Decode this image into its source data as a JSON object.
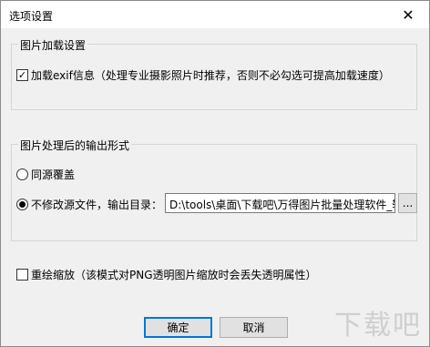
{
  "window": {
    "title": "选项设置",
    "close_glyph": "✕"
  },
  "loading_group": {
    "title": "图片加载设置",
    "exif_checkbox": {
      "checked": true,
      "label": "加载exif信息（处理专业摄影照片时推荐，否则不必勾选可提高加载速度）"
    }
  },
  "output_group": {
    "title": "图片处理后的输出形式",
    "options": [
      {
        "label": "同源覆盖",
        "selected": false
      },
      {
        "label": "不修改源文件，输出目录：",
        "selected": true
      }
    ],
    "output_path": "D:\\tools\\桌面\\下载吧\\万得图片批量处理软件_输",
    "browse_label": "..."
  },
  "redraw_checkbox": {
    "checked": false,
    "label": "重绘缩放（该模式对PNG透明图片缩放时会丢失透明属性）"
  },
  "buttons": {
    "ok": "确定",
    "cancel": "取消"
  },
  "watermark": "下载吧"
}
